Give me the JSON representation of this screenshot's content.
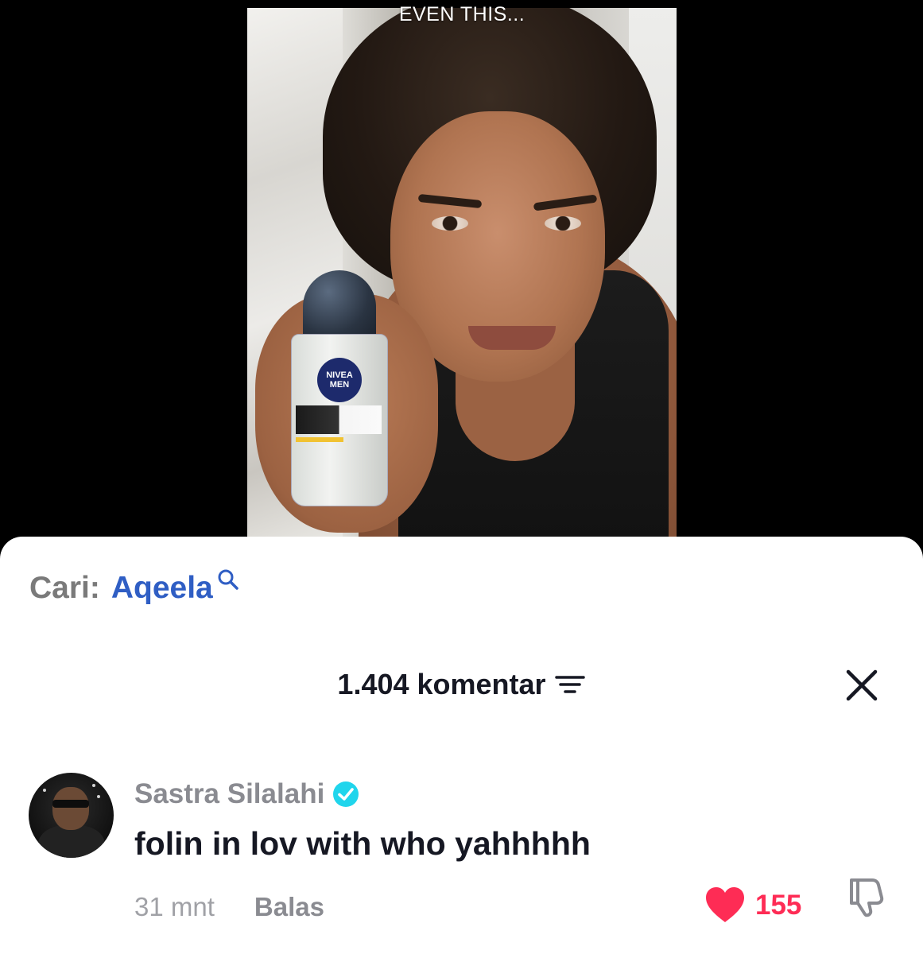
{
  "video": {
    "caption": "EVEN THIS...",
    "product_brand": "NIVEA",
    "product_line": "MEN"
  },
  "search": {
    "label": "Cari:",
    "term": "Aqeela",
    "icon": "search-icon"
  },
  "comments": {
    "count_label": "1.404 komentar",
    "sort_icon": "sort-icon",
    "close_icon": "close-icon"
  },
  "comment": {
    "username": "Sastra Silalahi",
    "verified": true,
    "text": "folin in lov with who yahhhhh",
    "timestamp": "31 mnt",
    "reply_label": "Balas",
    "likes": "155",
    "liked": true
  },
  "colors": {
    "accent_like": "#fe2c55",
    "search_term": "#2f5ec4",
    "verified": "#20d5ec",
    "text_primary": "#161823",
    "text_secondary": "#8a8b91"
  }
}
